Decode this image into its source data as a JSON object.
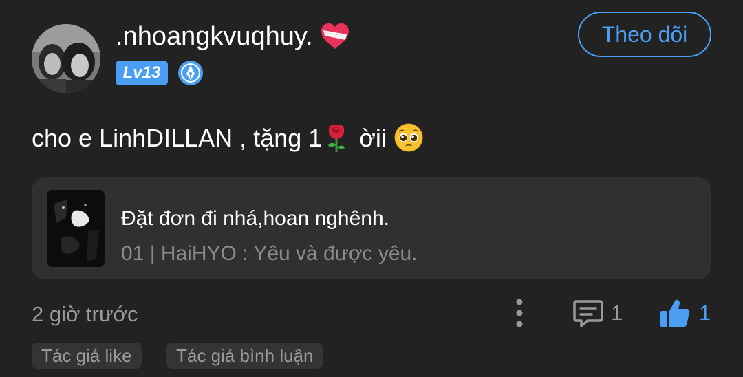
{
  "user": {
    "name": ".nhoangkvuqhuy.",
    "name_emoji": "mending-heart-icon",
    "level": "Lv13",
    "badge_icon": "creator-pen-icon"
  },
  "follow_button": {
    "label": "Theo dõi"
  },
  "post": {
    "text_before_rose": "cho e LinhDILLAN , tặng 1",
    "text_after_rose": " ời",
    "text_trailing": "i "
  },
  "song": {
    "title": "Đặt đơn đi nhá,hoan nghênh.",
    "subtitle": "01 | HaiHYO : Yêu và được yêu."
  },
  "meta": {
    "timestamp": "2 giờ trước",
    "comment_count": "1",
    "like_count": "1"
  },
  "tags": [
    {
      "label": "Tác giả like"
    },
    {
      "label": "Tác giả bình luận"
    }
  ],
  "colors": {
    "background": "#222223",
    "accent": "#4a9ff5",
    "card": "#303031",
    "muted_text": "#9a9a9a"
  }
}
